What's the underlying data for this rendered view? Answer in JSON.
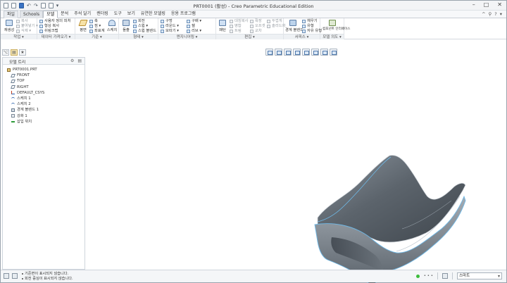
{
  "window": {
    "title": "PRT0001 (활성) - Creo Parametric Educational Edition"
  },
  "quick_access": {
    "icons": [
      "new-icon",
      "open-icon",
      "save-icon",
      "undo-icon",
      "redo-icon",
      "regenerate-icon",
      "windows-icon",
      "customize-icon"
    ],
    "undo_glyph": "↶",
    "redo_glyph": "↷",
    "dropdown_glyph": "▾"
  },
  "window_controls": {
    "minimize": "–",
    "maximize": "□",
    "close": "✕"
  },
  "tabs": [
    "파일",
    "Schools",
    "모델",
    "분석",
    "주석 달기",
    "렌더링",
    "도구",
    "보기",
    "유연한 모델링",
    "응용 프로그램"
  ],
  "help_glyphs": {
    "collapse": "^",
    "search": "⚲",
    "help": "?",
    "more": "▾"
  },
  "ribbon": {
    "groups": {
      "operations": "작업 ▾",
      "get_data": "데이터 가져오기 ▾",
      "datum": "기준 ▾",
      "shapes": "형태 ▾",
      "engineering": "엔지니어링 ▾",
      "editing": "편집 ▾",
      "surfaces": "서피스 ▾",
      "model_intent": "모델 의도 ▾"
    },
    "operations": {
      "regenerate": "재생성",
      "copy": "복사",
      "paste": "붙여넣기 ▾",
      "delete": "삭제 ▾"
    },
    "get_data": {
      "udf": "사용자 정의 피처",
      "copy_geom": "형상 복사",
      "shrinkwrap": "쉬링크랩"
    },
    "datum": {
      "plane": "평면",
      "axis": "축",
      "point": "점 ▾",
      "csys": "좌표계",
      "sketch": "스케치"
    },
    "shapes": {
      "extrude": "돌출",
      "revolve": "회전",
      "sweep": "스윕 ▾",
      "swept_blend": "스윕 블렌드"
    },
    "engineering": {
      "hole": "구멍",
      "round": "라운드 ▾",
      "chamfer": "모따기 ▾",
      "draft": "구배 ▾",
      "shell": "쉘",
      "rib": "리브 ▾"
    },
    "editing": {
      "pattern": "패턴",
      "mirror": "대칭복사",
      "merge": "병합",
      "trim": "트림",
      "extend": "확장",
      "offset": "오프셋",
      "intersect": "교차",
      "thicken": "두껍게",
      "solidify": "솔리드화"
    },
    "surfaces": {
      "boundary_blend": "경계 블렌드",
      "fill": "채우기",
      "style": "유형",
      "freestyle": "자유 유형"
    },
    "model_intent": {
      "component_interface": "컴포넌트 인터페이스"
    }
  },
  "view_toolbar": [
    "refit-icon",
    "zoom-in-icon",
    "zoom-out-icon",
    "repaint-icon",
    "display-style-icon",
    "saved-views-icon",
    "datum-display-icon",
    "annotation-display-icon"
  ],
  "nav_tabs": {
    "tree": "⌥",
    "folder": "▤",
    "favorites": "★"
  },
  "model_tree": {
    "header": "모델 트리",
    "tools": {
      "settings": "⚙",
      "show": "▤"
    },
    "nodes": [
      {
        "label": "PRT0001.PRT",
        "icon": "part",
        "indent": 0
      },
      {
        "label": "FRONT",
        "icon": "plane",
        "indent": 1
      },
      {
        "label": "TOP",
        "icon": "plane",
        "indent": 1
      },
      {
        "label": "RIGHT",
        "icon": "plane",
        "indent": 1
      },
      {
        "label": "DEFAULT_CSYS",
        "icon": "csys",
        "indent": 1
      },
      {
        "label": "스케치 1",
        "icon": "sketch",
        "indent": 1
      },
      {
        "label": "스케치 2",
        "icon": "sketch",
        "indent": 1
      },
      {
        "label": "경계 블렌드 1",
        "icon": "blend",
        "indent": 1
      },
      {
        "label": "강화 1",
        "icon": "reinf",
        "indent": 1
      },
      {
        "label": "삽입 위치",
        "icon": "insert",
        "indent": 1
      }
    ]
  },
  "status": {
    "messages": [
      "기준면이 표시되지 않습니다.",
      "회전 중심이 표시되지 않습니다."
    ],
    "filter": "스마트",
    "indicator_color": "#3cbc3c"
  },
  "colors": {
    "surface_dark": "#4c545c",
    "surface_light": "#8a939c",
    "edge_highlight": "#6fb8e6",
    "accent_tab": "#ffffff"
  }
}
